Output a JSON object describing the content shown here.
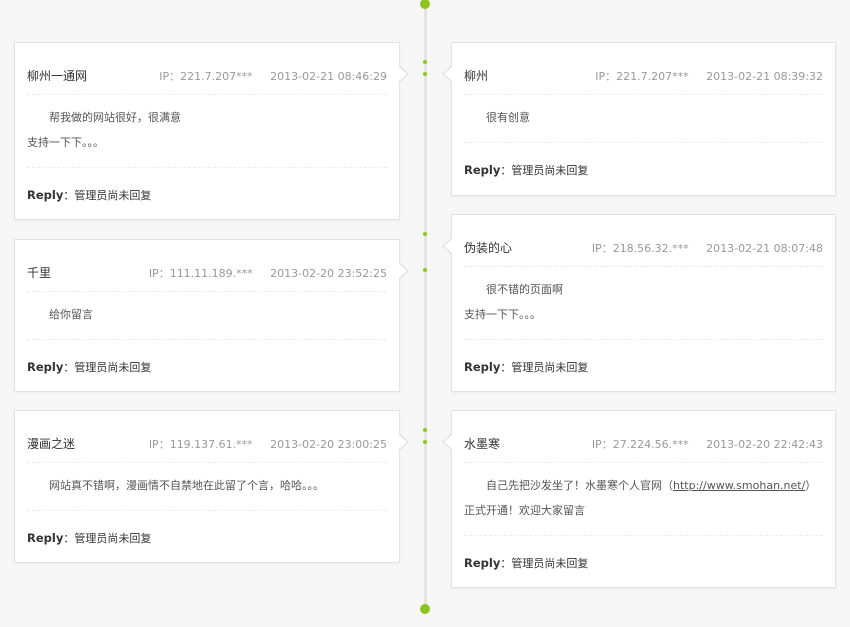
{
  "timeline": {
    "accent": "#8fc31f"
  },
  "messages_left": [
    {
      "name": "柳州一通网",
      "ip": "IP：221.7.207***",
      "time": "2013-02-21 08:46:29",
      "lines": [
        "帮我做的网站很好，很满意",
        "支持一下下。。。"
      ],
      "reply_label": "Reply",
      "reply_text": "：管理员尚未回复"
    },
    {
      "name": "千里",
      "ip": "IP：111.11.189.***",
      "time": "2013-02-20 23:52:25",
      "lines": [
        "给你留言"
      ],
      "reply_label": "Reply",
      "reply_text": "：管理员尚未回复"
    },
    {
      "name": "漫画之迷",
      "ip": "IP：119.137.61.***",
      "time": "2013-02-20 23:00:25",
      "lines": [
        "网站真不错啊，漫画情不自禁地在此留了个言，哈哈。。。"
      ],
      "reply_label": "Reply",
      "reply_text": "：管理员尚未回复"
    }
  ],
  "messages_right": [
    {
      "name": "柳州",
      "ip": "IP：221.7.207***",
      "time": "2013-02-21 08:39:32",
      "lines": [
        "很有创意"
      ],
      "reply_label": "Reply",
      "reply_text": "：管理员尚未回复"
    },
    {
      "name": "伪装的心",
      "ip": "IP：218.56.32.***",
      "time": "2013-02-21 08:07:48",
      "lines": [
        "很不错的页面啊",
        "支持一下下。。。"
      ],
      "reply_label": "Reply",
      "reply_text": "：管理员尚未回复"
    },
    {
      "name": "水墨寒",
      "ip": "IP：27.224.56.***",
      "time": "2013-02-20 22:42:43",
      "text_before_link": "自己先把沙发坐了！水墨寒个人官网（",
      "link": "http://www.smohan.net/",
      "text_after_link": "）正式开通！欢迎大家留言",
      "reply_label": "Reply",
      "reply_text": "：管理员尚未回复"
    }
  ]
}
